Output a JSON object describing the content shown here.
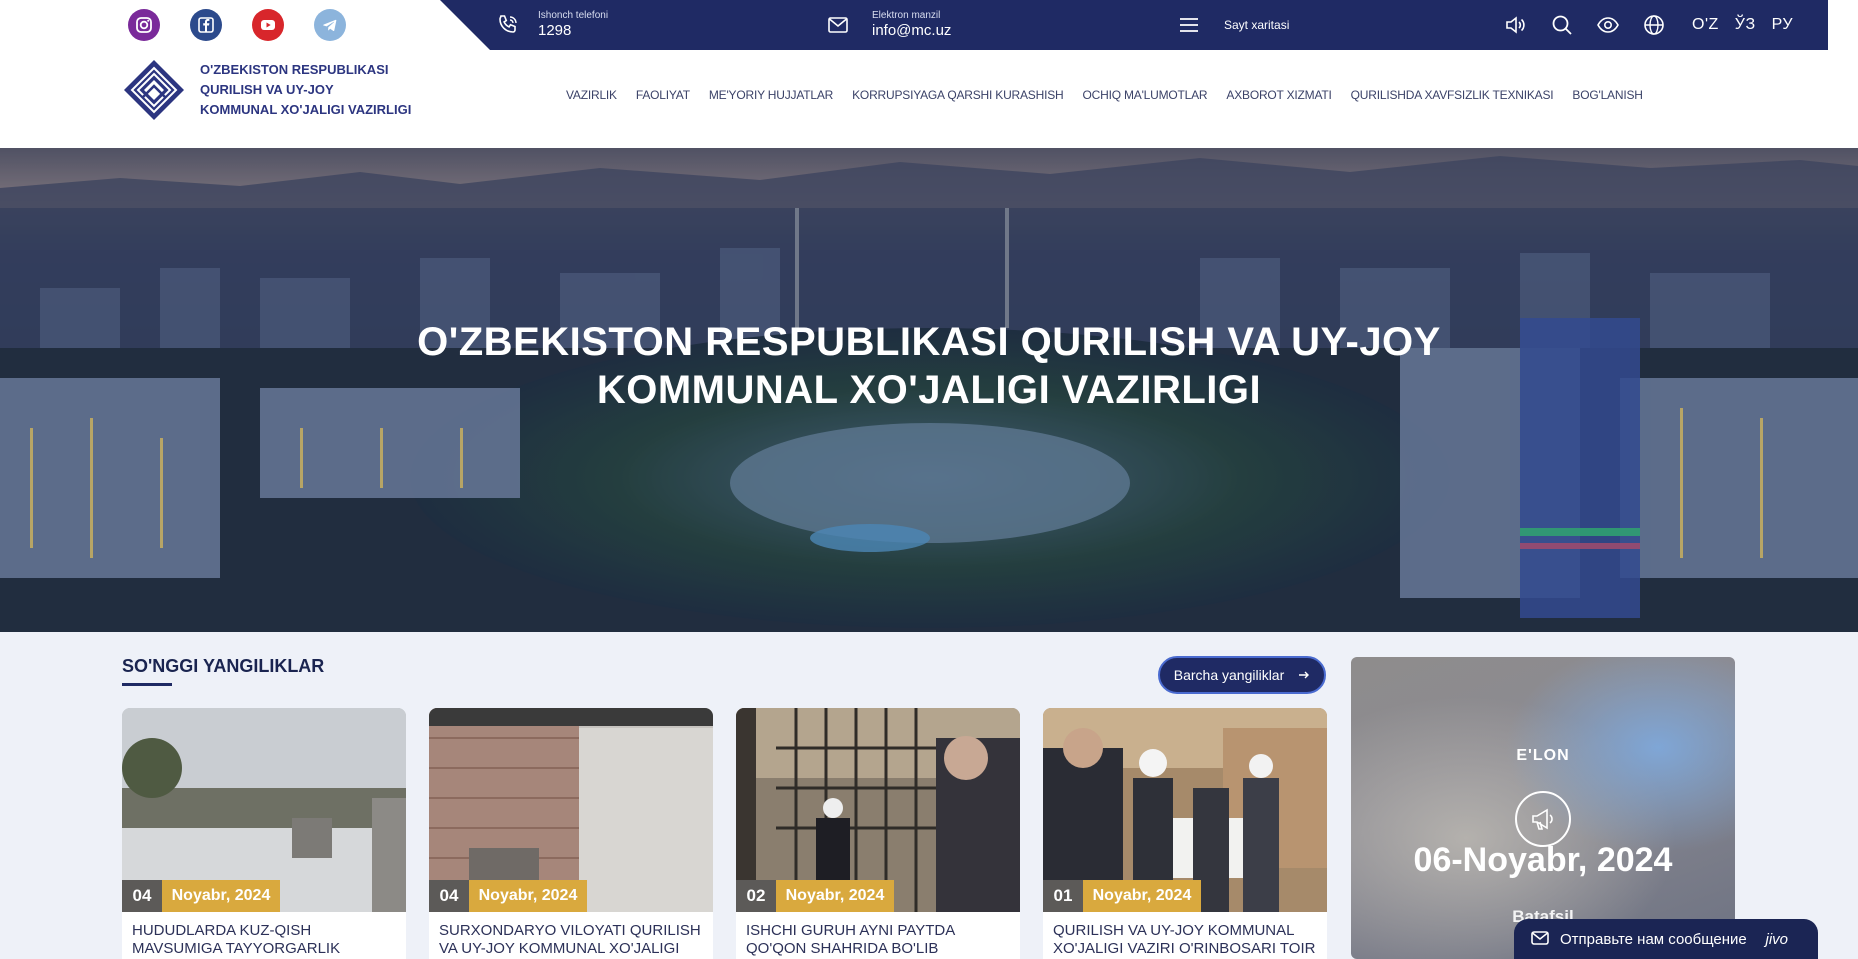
{
  "header": {
    "socials": [
      {
        "name": "instagram-icon"
      },
      {
        "name": "facebook-icon"
      },
      {
        "name": "youtube-icon"
      },
      {
        "name": "telegram-icon"
      }
    ],
    "phone": {
      "label": "Ishonch telefoni",
      "value": "1298"
    },
    "email": {
      "label": "Elektron manzil",
      "value": "info@mc.uz"
    },
    "sitemap": "Sayt xaritasi",
    "languages": [
      "O'Z",
      "ЎЗ",
      "РУ"
    ],
    "logo_lines": [
      "O'ZBEKISTON RESPUBLIKASI",
      "QURILISH VA UY-JOY",
      "KOMMUNAL XO'JALIGI VAZIRLIGI"
    ],
    "nav": [
      "VAZIRLIK",
      "FAOLIYAT",
      "ME'YORIY HUJJATLAR",
      "KORRUPSIYAGA QARSHI KURASHISH",
      "OCHIQ MA'LUMOTLAR",
      "AXBOROT XIZMATI",
      "QURILISHDA XAVFSIZLIK TEXNIKASI",
      "BOG'LANISH"
    ]
  },
  "hero": {
    "title_line1": "O'ZBEKISTON RESPUBLIKASI QURILISH VA UY-JOY",
    "title_line2": "KOMMUNAL XO'JALIGI VAZIRLIGI"
  },
  "news": {
    "section_title": "SO'NGGI YANGILIKLAR",
    "all_button": "Barcha yangiliklar",
    "items": [
      {
        "day": "04",
        "month": "Noyabr, 2024",
        "title": "HUDUDLARDA KUZ-QISH MAVSUMIGA TAYYORGARLIK"
      },
      {
        "day": "04",
        "month": "Noyabr, 2024",
        "title": "SURXONDARYO VILOYATI QURILISH VA UY-JOY KOMMUNAL XO'JALIGI"
      },
      {
        "day": "02",
        "month": "Noyabr, 2024",
        "title": "ISHCHI GURUH AYNI PAYTDA QO'QON SHAHRIDA BO'LIB"
      },
      {
        "day": "01",
        "month": "Noyabr, 2024",
        "title": "QURILISH VA UY-JOY KOMMUNAL XO'JALIGI VAZIRI O'RINBOSARI TOIR"
      }
    ]
  },
  "announcement": {
    "label": "E'LON",
    "date": "06-Noyabr, 2024",
    "more": "Batafsil"
  },
  "chat": {
    "label": "Отправьте нам сообщение",
    "brand": "jivo"
  }
}
